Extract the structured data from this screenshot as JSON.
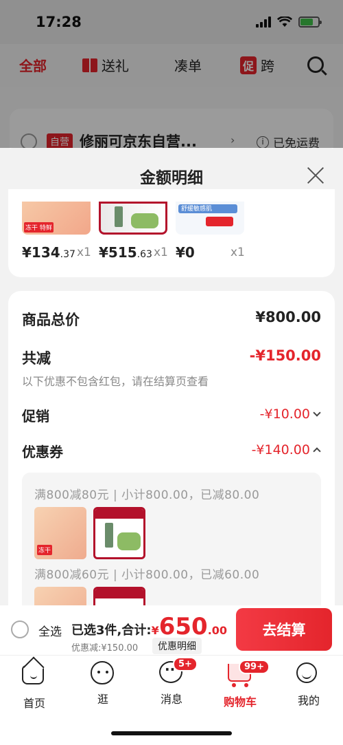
{
  "status_bar": {
    "time": "17:28"
  },
  "bg_tabs": {
    "all": "全部",
    "gift": "送礼",
    "bundle": "凑单",
    "promo_badge": "促",
    "cross": "跨"
  },
  "bg_shop": {
    "self_tag": "自营",
    "name": "修丽可京东自营...",
    "shipping": "已免运费"
  },
  "sheet": {
    "title": "金额明细"
  },
  "products": [
    {
      "price_int": "¥134",
      "price_dec": ".37",
      "qty": "x1",
      "tag": "冻干 特鲜"
    },
    {
      "price_int": "¥515",
      "price_dec": ".63",
      "qty": "x1"
    },
    {
      "price_int": "¥0",
      "price_dec": "",
      "qty": "x1",
      "label": "舒缓敏感肌"
    }
  ],
  "summary": {
    "total_label": "商品总价",
    "total_value": "¥800.00",
    "reduce_label": "共减",
    "reduce_value": "-¥150.00",
    "note": "以下优惠不包含红包，请在结算页查看",
    "promo_label": "促销",
    "promo_value": "-¥10.00",
    "coupon_label": "优惠券",
    "coupon_value": "-¥140.00",
    "coupons": [
      {
        "text": "满800减80元 | 小计800.00，已减80.00"
      },
      {
        "text": "满800减60元 | 小计800.00，已减60.00"
      }
    ]
  },
  "checkout": {
    "select_all": "全选",
    "selected_text": "已选3件,合计:",
    "currency": "¥",
    "total_int": "650",
    "total_dec": ".00",
    "discount": "优惠减:¥150.00",
    "detail_link": "优惠明细",
    "pay_button": "去结算"
  },
  "tabbar": {
    "items": [
      {
        "label": "首页",
        "badge": ""
      },
      {
        "label": "逛",
        "badge": ""
      },
      {
        "label": "消息",
        "badge": "5+"
      },
      {
        "label": "购物车",
        "badge": "99+"
      },
      {
        "label": "我的",
        "badge": ""
      }
    ]
  },
  "colors": {
    "accent": "#e4252c",
    "background": "#f2f2f2"
  }
}
